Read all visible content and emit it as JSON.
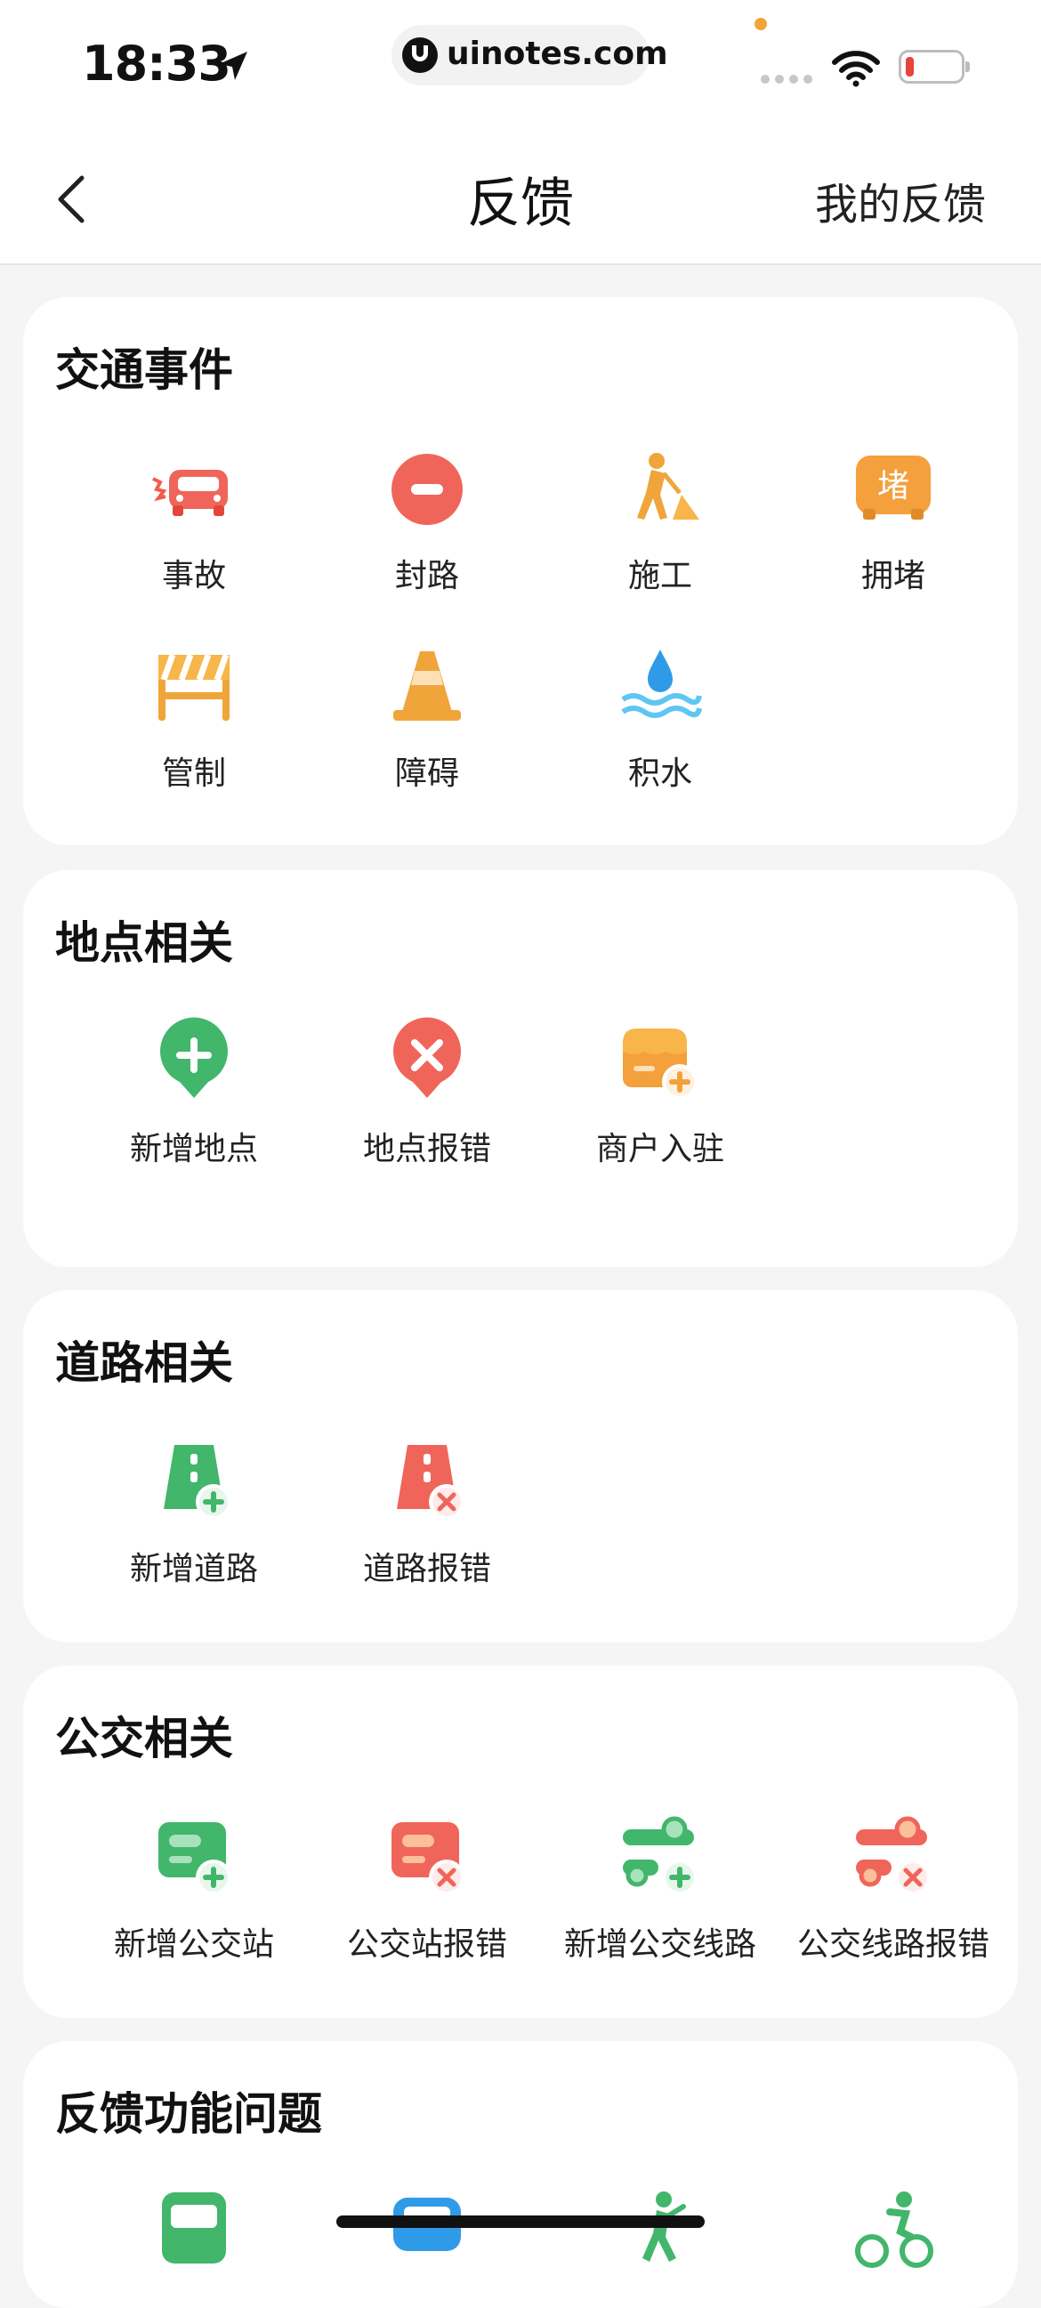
{
  "status_bar": {
    "time": "18:33",
    "url": "uinotes.com"
  },
  "nav": {
    "title": "反馈",
    "right_label": "我的反馈"
  },
  "sections": [
    {
      "title": "交通事件",
      "items": [
        {
          "label": "事故",
          "icon": "car-crash-icon"
        },
        {
          "label": "封路",
          "icon": "road-closed-icon"
        },
        {
          "label": "施工",
          "icon": "construction-worker-icon"
        },
        {
          "label": "拥堵",
          "icon": "traffic-jam-icon"
        },
        {
          "label": "管制",
          "icon": "barrier-icon"
        },
        {
          "label": "障碍",
          "icon": "traffic-cone-icon"
        },
        {
          "label": "积水",
          "icon": "water-icon"
        }
      ]
    },
    {
      "title": "地点相关",
      "items": [
        {
          "label": "新增地点",
          "icon": "add-place-icon"
        },
        {
          "label": "地点报错",
          "icon": "place-error-icon"
        },
        {
          "label": "商户入驻",
          "icon": "shop-join-icon"
        }
      ]
    },
    {
      "title": "道路相关",
      "items": [
        {
          "label": "新增道路",
          "icon": "add-road-icon"
        },
        {
          "label": "道路报错",
          "icon": "road-error-icon"
        }
      ]
    },
    {
      "title": "公交相关",
      "items": [
        {
          "label": "新增公交站",
          "icon": "add-bus-stop-icon"
        },
        {
          "label": "公交站报错",
          "icon": "bus-stop-error-icon"
        },
        {
          "label": "新增公交线路",
          "icon": "add-bus-line-icon"
        },
        {
          "label": "公交线路报错",
          "icon": "bus-line-error-icon"
        }
      ]
    },
    {
      "title": "反馈功能问题",
      "items": [
        {
          "label": "",
          "icon": "bus-icon"
        },
        {
          "label": "",
          "icon": "car-icon"
        },
        {
          "label": "",
          "icon": "walking-icon"
        },
        {
          "label": "",
          "icon": "cycling-icon"
        }
      ]
    }
  ]
}
